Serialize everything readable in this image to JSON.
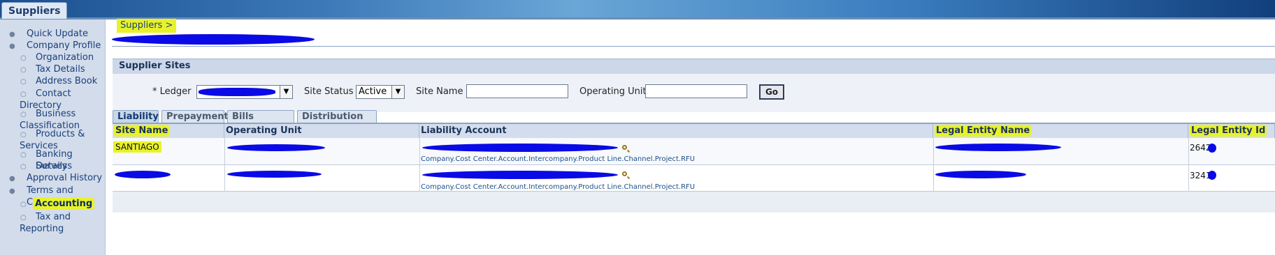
{
  "header": {
    "tab_label": "Suppliers"
  },
  "sidebar": {
    "items": [
      {
        "label": "Quick Update",
        "level": 1
      },
      {
        "label": "Company Profile",
        "level": 1
      },
      {
        "label": "Organization",
        "level": 2
      },
      {
        "label": "Tax Details",
        "level": 2
      },
      {
        "label": "Address Book",
        "level": 2
      },
      {
        "label": "Contact Directory",
        "level": 2
      },
      {
        "label": "Business Classification",
        "level": 2
      },
      {
        "label": "Products & Services",
        "level": 2
      },
      {
        "label": "Banking Details",
        "level": 2
      },
      {
        "label": "Surveys",
        "level": 2
      },
      {
        "label": "Approval History",
        "level": 1
      },
      {
        "label": "Terms and Control",
        "level": 1
      },
      {
        "label": "Accounting",
        "level": 2,
        "selected": true
      },
      {
        "label": "Tax and Reporting",
        "level": 2
      }
    ]
  },
  "main": {
    "breadcrumb": "Suppliers  >",
    "section_title": "Supplier Sites",
    "search": {
      "ledger_label": "* Ledger",
      "site_status_label": "Site Status",
      "site_status_value": "Active",
      "site_name_label": "Site Name",
      "operating_unit_label": "Operating Unit",
      "go_label": "Go"
    },
    "tabs": [
      "Liability",
      "Prepayment",
      "Bills Payable",
      "Distribution Set"
    ],
    "table": {
      "columns": [
        "Site Name",
        "Operating Unit",
        "Liability Account",
        "Legal Entity Name",
        "Legal Entity Id"
      ],
      "rows": [
        {
          "site_name": "SANTIAGO",
          "account_structure": "Company.Cost Center.Account.Intercompany.Product Line.Channel.Project.RFU",
          "legal_entity_id": "2642"
        },
        {
          "site_name": "",
          "account_structure": "Company.Cost Center.Account.Intercompany.Product Line.Channel.Project.RFU",
          "legal_entity_id": "3241"
        }
      ]
    }
  },
  "colors": {
    "highlight": "#e8f22a",
    "redaction": "#0a0ae6",
    "header_blue": "#1a4f8f"
  }
}
